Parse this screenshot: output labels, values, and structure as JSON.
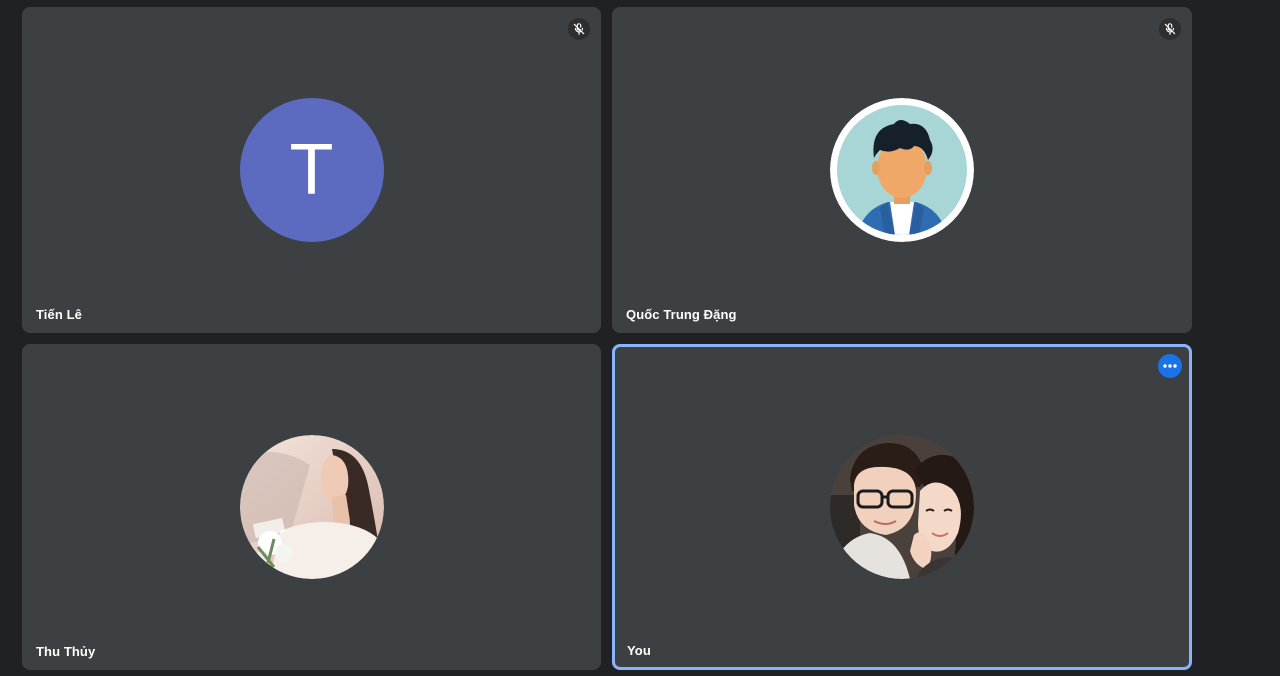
{
  "participants": [
    {
      "name": "Tiến Lê",
      "avatar_type": "letter",
      "avatar_letter": "T",
      "avatar_color": "#5c6bc0",
      "muted": true,
      "status_icon": "mic-off-icon"
    },
    {
      "name": "Quốc Trung Đặng",
      "avatar_type": "illustration",
      "avatar_icon": "default-person-avatar-icon",
      "muted": true,
      "status_icon": "mic-off-icon"
    },
    {
      "name": "Thu Thủy",
      "avatar_type": "photo",
      "avatar_icon": "profile-photo",
      "muted": false
    },
    {
      "name": "You",
      "avatar_type": "photo",
      "avatar_icon": "profile-photo",
      "active": true,
      "action_icon": "more-options-icon"
    }
  ],
  "colors": {
    "background": "#202124",
    "tile": "#3c4043",
    "active_border": "#8ab4f8",
    "accent": "#1a73e8"
  }
}
